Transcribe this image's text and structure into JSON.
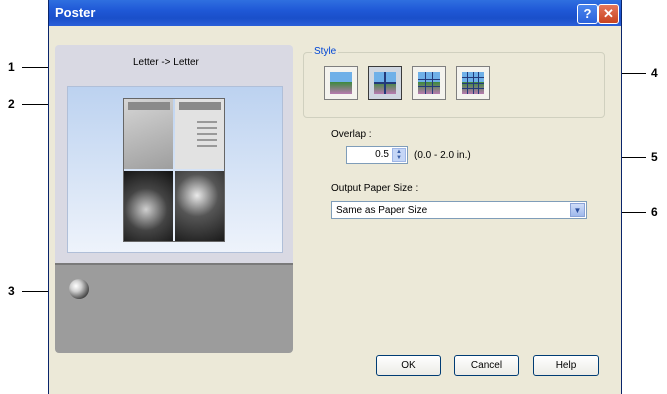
{
  "window": {
    "title": "Poster"
  },
  "titlebar_buttons": {
    "help": "?",
    "close": "✕"
  },
  "callouts": [
    "1",
    "2",
    "3",
    "4",
    "5",
    "6"
  ],
  "preview": {
    "label": "Letter -> Letter"
  },
  "style": {
    "legend": "Style",
    "options": [
      {
        "icon": "poster-1x1-icon",
        "selected": false
      },
      {
        "icon": "poster-2x2-icon",
        "selected": true
      },
      {
        "icon": "poster-3x3-icon",
        "selected": false
      },
      {
        "icon": "poster-4x4-icon",
        "selected": false
      }
    ]
  },
  "overlap": {
    "label": "Overlap :",
    "value": "0.5",
    "range": "(0.0 - 2.0 in.)"
  },
  "output": {
    "label": "Output Paper Size :",
    "value": "Same as Paper Size"
  },
  "buttons": {
    "ok": "OK",
    "cancel": "Cancel",
    "help": "Help"
  }
}
